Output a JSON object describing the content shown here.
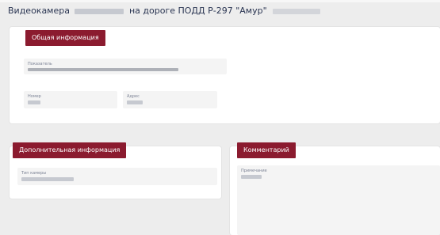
{
  "page": {
    "title_start": "Видеокамера",
    "title_middle": "на дороге ПОДД Р-297 \"Амур\""
  },
  "general_card": {
    "header": "Общая информация",
    "field1": {
      "label": "Показатель"
    },
    "field2": {
      "label": "Номер"
    },
    "field3": {
      "label": "Адрес"
    }
  },
  "additional_card": {
    "header": "Дополнительная информация",
    "field1": {
      "label": "Тип камеры"
    }
  },
  "comment_card": {
    "header": "Комментарий",
    "field1": {
      "label": "Примечание"
    }
  },
  "colors": {
    "accent": "#8b1b2f",
    "background": "#ededed",
    "card": "#ffffff",
    "field": "#f4f4f4",
    "title_text": "#2a3552"
  }
}
